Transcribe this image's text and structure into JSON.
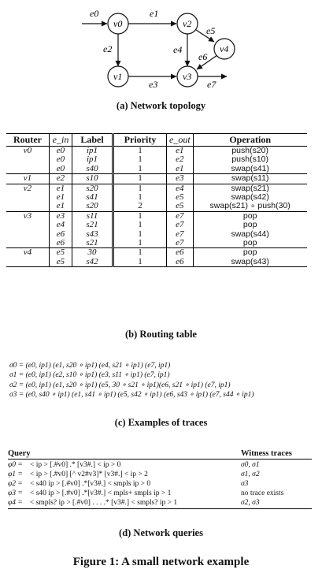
{
  "topology": {
    "nodes": [
      {
        "id": "v0",
        "label": "v0"
      },
      {
        "id": "v1",
        "label": "v1"
      },
      {
        "id": "v2",
        "label": "v2"
      },
      {
        "id": "v3",
        "label": "v3"
      },
      {
        "id": "v4",
        "label": "v4"
      }
    ],
    "edges": [
      {
        "id": "e0",
        "label": "e0",
        "from": "",
        "to": "v0"
      },
      {
        "id": "e1",
        "label": "e1",
        "from": "v0",
        "to": "v2"
      },
      {
        "id": "e2",
        "label": "e2",
        "from": "v0",
        "to": "v1"
      },
      {
        "id": "e3",
        "label": "e3",
        "from": "v1",
        "to": "v3"
      },
      {
        "id": "e4",
        "label": "e4",
        "from": "v2",
        "to": "v3"
      },
      {
        "id": "e5",
        "label": "e5",
        "from": "v2",
        "to": "v4"
      },
      {
        "id": "e6",
        "label": "e6",
        "from": "v4",
        "to": "v3"
      },
      {
        "id": "e7",
        "label": "e7",
        "from": "v3",
        "to": ""
      }
    ],
    "caption": "(a) Network topology"
  },
  "routing_table": {
    "headers": [
      "Router",
      "e_in",
      "Label",
      "Priority",
      "e_out",
      "Operation"
    ],
    "groups": [
      {
        "router": "v0",
        "rows": [
          {
            "ein": "e0",
            "label": "ip1",
            "priority": "1",
            "eout": "e1",
            "op": "push(s20)"
          },
          {
            "ein": "e0",
            "label": "ip1",
            "priority": "1",
            "eout": "e2",
            "op": "push(s10)"
          },
          {
            "ein": "e0",
            "label": "s40",
            "priority": "1",
            "eout": "e1",
            "op": "swap(s41)"
          }
        ]
      },
      {
        "router": "v1",
        "rows": [
          {
            "ein": "e2",
            "label": "s10",
            "priority": "1",
            "eout": "e3",
            "op": "swap(s11)"
          }
        ]
      },
      {
        "router": "v2",
        "rows": [
          {
            "ein": "e1",
            "label": "s20",
            "priority": "1",
            "eout": "e4",
            "op": "swap(s21)"
          },
          {
            "ein": "e1",
            "label": "s41",
            "priority": "1",
            "eout": "e5",
            "op": "swap(s42)"
          },
          {
            "ein": "e1",
            "label": "s20",
            "priority": "2",
            "eout": "e5",
            "op": "swap(s21) ∘ push(30)"
          }
        ]
      },
      {
        "router": "v3",
        "rows": [
          {
            "ein": "e3",
            "label": "s11",
            "priority": "1",
            "eout": "e7",
            "op": "pop"
          },
          {
            "ein": "e4",
            "label": "s21",
            "priority": "1",
            "eout": "e7",
            "op": "pop"
          },
          {
            "ein": "e6",
            "label": "s43",
            "priority": "1",
            "eout": "e7",
            "op": "swap(s44)"
          },
          {
            "ein": "e6",
            "label": "s21",
            "priority": "1",
            "eout": "e7",
            "op": "pop"
          }
        ]
      },
      {
        "router": "v4",
        "rows": [
          {
            "ein": "e5",
            "label": "30",
            "priority": "1",
            "eout": "e6",
            "op": "pop"
          },
          {
            "ein": "e5",
            "label": "s42",
            "priority": "1",
            "eout": "e6",
            "op": "swap(s43)"
          }
        ]
      }
    ],
    "caption": "(b) Routing table"
  },
  "traces": {
    "items": [
      "σ0 = (e0, ip1) (e1, s20 ∘ ip1) (e4, s21 ∘ ip1) (e7, ip1)",
      "σ1 = (e0, ip1) (e2, s10 ∘ ip1) (e3, s11 ∘ ip1) (e7, ip1)",
      "σ2 = (e0, ip1) (e1, s20 ∘ ip1) (e5, 30 ∘ s21 ∘ ip1)(e6, s21 ∘ ip1) (e7, ip1)",
      "σ3 = (e0, s40 ∘ ip1) (e1, s41 ∘ ip1) (e5, s42 ∘ ip1) (e6, s43 ∘ ip1) (e7, s44 ∘ ip1)"
    ],
    "caption": "(c) Examples of traces"
  },
  "queries": {
    "header_query": "Query",
    "header_witness": "Witness traces",
    "items": [
      {
        "name": "φ0 =",
        "expr": "< ip > [.#v0] .* [v3#.] < ip > 0",
        "witness": "σ0, σ1"
      },
      {
        "name": "φ1 =",
        "expr": "< ip > [.#v0] [^ v2#v3]* [v3#.] < ip > 2",
        "witness": "σ1, σ2"
      },
      {
        "name": "φ2 =",
        "expr": "< s40 ip > [.#v0] .*[v3#.] < smpls ip > 0",
        "witness": "σ3"
      },
      {
        "name": "φ3 =",
        "expr": "< s40 ip > [.#v0] .*[v3#.] < mpls+ smpls ip > 1",
        "witness": "no trace exists"
      },
      {
        "name": "φ4 =",
        "expr": "< smpls? ip > [.#v0] . . . .* [v3#.] < smpls? ip > 1",
        "witness": "σ2, σ3"
      }
    ],
    "caption": "(d) Network queries"
  },
  "figure_caption": "Figure 1: A small network example"
}
